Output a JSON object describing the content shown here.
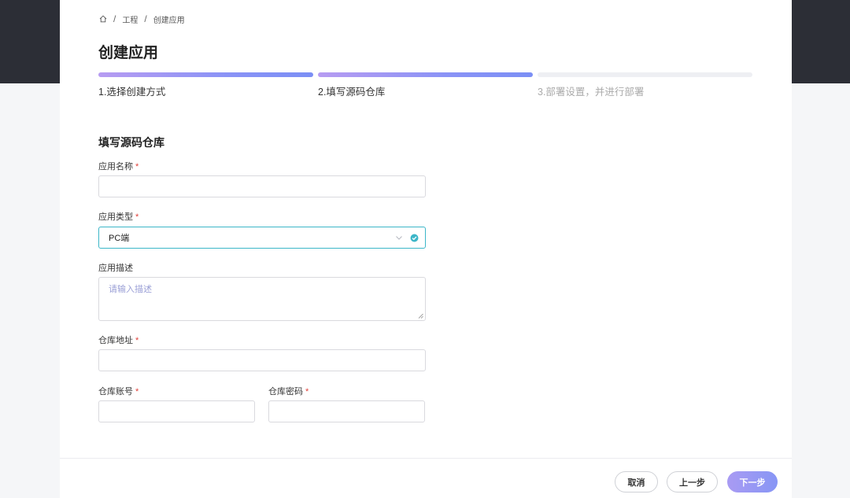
{
  "breadcrumb": {
    "items": [
      "工程",
      "创建应用"
    ],
    "separator": "/"
  },
  "page_title": "创建应用",
  "steps": [
    {
      "label": "1.选择创建方式",
      "state": "done"
    },
    {
      "label": "2.填写源码仓库",
      "state": "current"
    },
    {
      "label": "3.部署设置，并进行部署",
      "state": "pending"
    }
  ],
  "form": {
    "section_title": "填写源码仓库",
    "required_mark": "*",
    "app_name": {
      "label": "应用名称",
      "value": ""
    },
    "app_type": {
      "label": "应用类型",
      "value": "PC端"
    },
    "app_desc": {
      "label": "应用描述",
      "placeholder": "请输入描述"
    },
    "repo_url": {
      "label": "仓库地址",
      "value": ""
    },
    "repo_account": {
      "label": "仓库账号",
      "value": ""
    },
    "repo_password": {
      "label": "仓库密码",
      "value": ""
    }
  },
  "footer": {
    "cancel": "取消",
    "prev": "上一步",
    "next": "下一步"
  },
  "colors": {
    "accent": "#8a93f6",
    "select_border": "#3cb6c8",
    "required": "#e0413a",
    "top_band": "#2c2e36"
  }
}
